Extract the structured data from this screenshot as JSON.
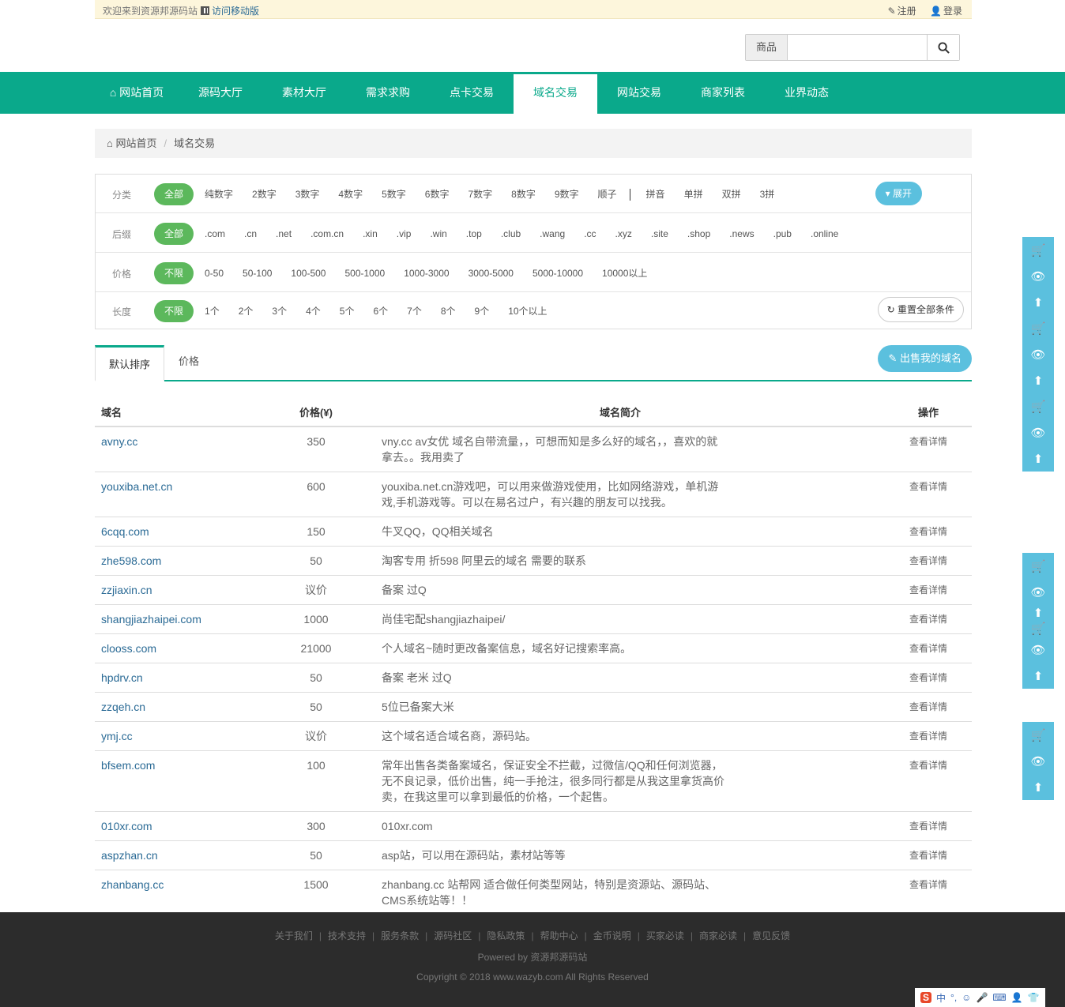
{
  "topbar": {
    "welcome": "欢迎来到资源邦源码站",
    "mobile": "访问移动版",
    "register": "注册",
    "login": "登录"
  },
  "search": {
    "category": "商品",
    "value": "",
    "placeholder": ""
  },
  "nav": [
    "网站首页",
    "源码大厅",
    "素材大厅",
    "需求求购",
    "点卡交易",
    "域名交易",
    "网站交易",
    "商家列表",
    "业界动态"
  ],
  "breadcrumb": {
    "home": "网站首页",
    "current": "域名交易"
  },
  "filters": {
    "category": {
      "label": "分类",
      "options": [
        "全部",
        "纯数字",
        "2数字",
        "3数字",
        "4数字",
        "5数字",
        "6数字",
        "7数字",
        "8数字",
        "9数字",
        "顺子"
      ],
      "options2": [
        "拼音",
        "单拼",
        "双拼",
        "3拼"
      ],
      "expand": "展开"
    },
    "suffix": {
      "label": "后缀",
      "options": [
        "全部",
        ".com",
        ".cn",
        ".net",
        ".com.cn",
        ".xin",
        ".vip",
        ".win",
        ".top",
        ".club",
        ".wang",
        ".cc",
        ".xyz",
        ".site",
        ".shop",
        ".news",
        ".pub",
        ".online"
      ]
    },
    "price": {
      "label": "价格",
      "options": [
        "不限",
        "0-50",
        "50-100",
        "100-500",
        "500-1000",
        "1000-3000",
        "3000-5000",
        "5000-10000",
        "10000以上"
      ]
    },
    "length": {
      "label": "长度",
      "options": [
        "不限",
        "1个",
        "2个",
        "3个",
        "4个",
        "5个",
        "6个",
        "7个",
        "8个",
        "9个",
        "10个以上"
      ],
      "reset": "重置全部条件"
    }
  },
  "tabs": {
    "default": "默认排序",
    "price": "价格",
    "sell": "出售我的域名"
  },
  "table": {
    "headers": [
      "域名",
      "价格(¥)",
      "域名简介",
      "操作"
    ],
    "rows": [
      {
        "name": "avny.cc",
        "price": "350",
        "desc": "vny.cc av女优 域名自带流量，，可想而知是多么好的域名，，喜欢的就拿去。。我用卖了",
        "op": "查看详情"
      },
      {
        "name": "youxiba.net.cn",
        "price": "600",
        "desc": "youxiba.net.cn游戏吧，可以用来做游戏使用，比如网络游戏，单机游戏,手机游戏等。可以在易名过户，有兴趣的朋友可以找我。",
        "op": "查看详情"
      },
      {
        "name": "6cqq.com",
        "price": "150",
        "desc": "牛叉QQ，QQ相关域名",
        "op": "查看详情"
      },
      {
        "name": "zhe598.com",
        "price": "50",
        "desc": "淘客专用 折598 阿里云的域名 需要的联系",
        "op": "查看详情"
      },
      {
        "name": "zzjiaxin.cn",
        "price": "议价",
        "desc": "备案 过Q",
        "op": "查看详情"
      },
      {
        "name": "shangjiazhaipei.com",
        "price": "1000",
        "desc": "尚佳宅配shangjiazhaipei/",
        "op": "查看详情"
      },
      {
        "name": "clooss.com",
        "price": "21000",
        "desc": "个人域名~随时更改备案信息，域名好记搜索率高。",
        "op": "查看详情"
      },
      {
        "name": "hpdrv.cn",
        "price": "50",
        "desc": "备案 老米 过Q",
        "op": "查看详情"
      },
      {
        "name": "zzqeh.cn",
        "price": "50",
        "desc": "5位已备案大米",
        "op": "查看详情"
      },
      {
        "name": "ymj.cc",
        "price": "议价",
        "desc": "这个域名适合域名商，源码站。",
        "op": "查看详情"
      },
      {
        "name": "bfsem.com",
        "price": "100",
        "desc": "常年出售各类备案域名，保证安全不拦截，过微信/QQ和任何浏览器，无不良记录，低价出售，纯一手抢注，很多同行都是从我这里拿货高价卖，在我这里可以拿到最低的价格，一个起售。",
        "op": "查看详情"
      },
      {
        "name": "010xr.com",
        "price": "300",
        "desc": "010xr.com",
        "op": "查看详情"
      },
      {
        "name": "aspzhan.cn",
        "price": "50",
        "desc": "asp站，可以用在源码站，素材站等等",
        "op": "查看详情"
      },
      {
        "name": "zhanbang.cc",
        "price": "1500",
        "desc": "zhanbang.cc 站帮网 适合做任何类型网站，特别是资源站、源码站、CMS系统站等！！",
        "op": "查看详情"
      }
    ]
  },
  "footer": {
    "links": [
      "关于我们",
      "技术支持",
      "服务条款",
      "源码社区",
      "隐私政策",
      "帮助中心",
      "金币说明",
      "买家必读",
      "商家必读",
      "意见反馈"
    ],
    "powered": "Powered by 资源邦源码站",
    "copyright": "Copyright © 2018 www.wazyb.com All Rights Reserved"
  },
  "ime": {
    "lang": "中"
  },
  "colors": {
    "nav": "#0aa98b",
    "accent_blue": "#5bc0de",
    "selected_green": "#5cb85c",
    "link": "#2a6a95"
  }
}
